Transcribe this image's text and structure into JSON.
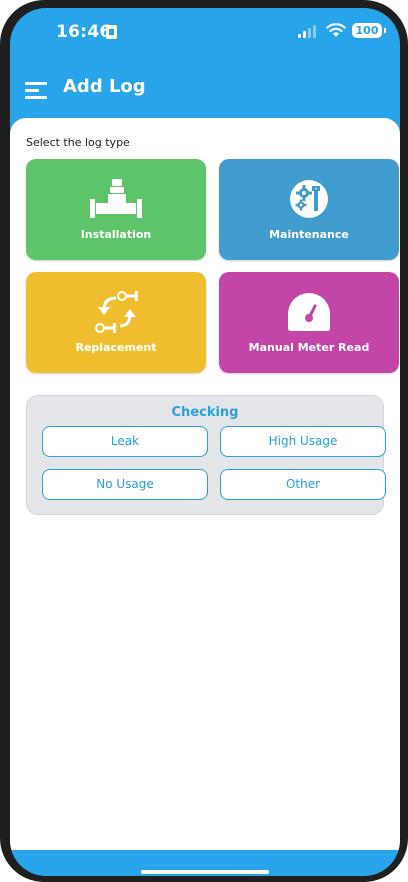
{
  "status_bar": {
    "time": "16:46",
    "battery": "100"
  },
  "app_bar": {
    "title": "Add Log"
  },
  "content": {
    "section_label": "Select the log type",
    "tiles": [
      {
        "label": "Installation",
        "icon": "pipe-valve-icon",
        "color": "#5dc46a"
      },
      {
        "label": "Maintenance",
        "icon": "gear-wrench-icon",
        "color": "#409ccd"
      },
      {
        "label": "Replacement",
        "icon": "swap-meter-icon",
        "color": "#efbd2e"
      },
      {
        "label": "Manual Meter Read",
        "icon": "gauge-icon",
        "color": "#c345a8"
      }
    ],
    "checking": {
      "title": "Checking",
      "buttons": [
        "Leak",
        "High Usage",
        "No Usage",
        "Other"
      ]
    }
  },
  "colors": {
    "brand": "#28a4ea",
    "accent_text": "#2a9fd8"
  }
}
